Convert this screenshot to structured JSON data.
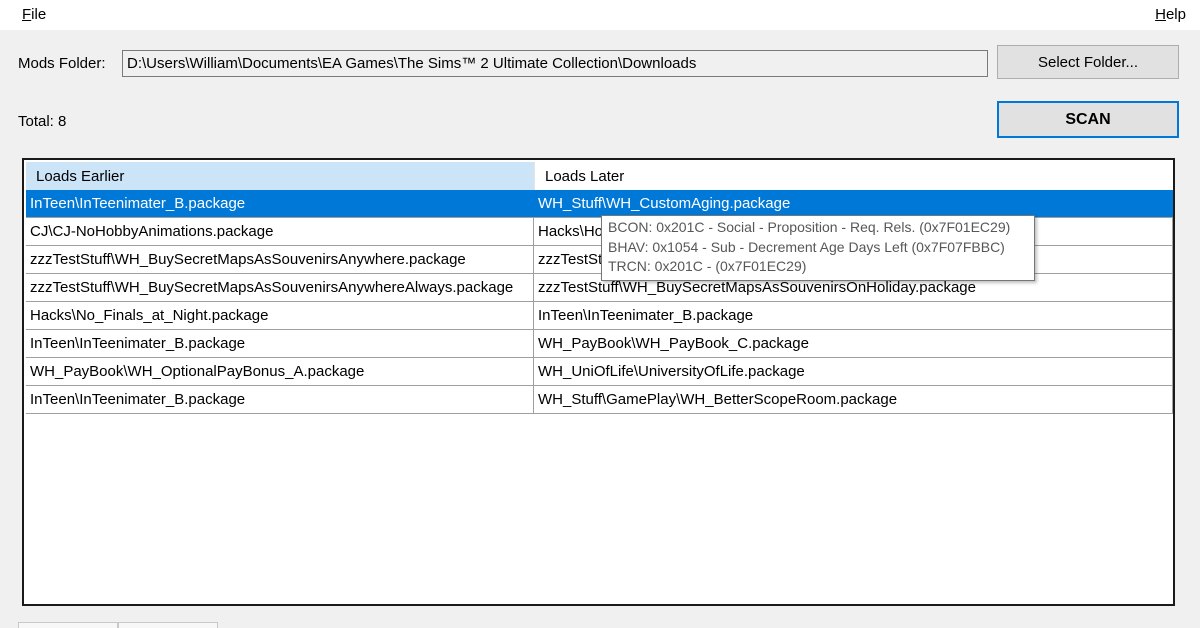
{
  "menu": {
    "file_label": "F",
    "file_rest": "ile",
    "help_label": "H",
    "help_rest": "elp"
  },
  "folder": {
    "label": "Mods Folder:",
    "value": "D:\\Users\\William\\Documents\\EA Games\\The Sims™ 2 Ultimate Collection\\Downloads",
    "select_button": "Select Folder..."
  },
  "scan_button": "SCAN",
  "total_label": "Total: 8",
  "table": {
    "headers": {
      "earlier": "Loads Earlier",
      "later": "Loads Later"
    },
    "rows": [
      {
        "earlier": "InTeen\\InTeenimater_B.package",
        "later": "WH_Stuff\\WH_CustomAging.package",
        "selected": true
      },
      {
        "earlier": "CJ\\CJ-NoHobbyAnimations.package",
        "later": "Hacks\\Ho"
      },
      {
        "earlier": "zzzTestStuff\\WH_BuySecretMapsAsSouvenirsAnywhere.package",
        "later": "zzzTestSt"
      },
      {
        "earlier": "zzzTestStuff\\WH_BuySecretMapsAsSouvenirsAnywhereAlways.package",
        "later": "zzzTestStuff\\WH_BuySecretMapsAsSouvenirsOnHoliday.package"
      },
      {
        "earlier": "Hacks\\No_Finals_at_Night.package",
        "later": "InTeen\\InTeenimater_B.package"
      },
      {
        "earlier": "InTeen\\InTeenimater_B.package",
        "later": "WH_PayBook\\WH_PayBook_C.package"
      },
      {
        "earlier": "WH_PayBook\\WH_OptionalPayBonus_A.package",
        "later": "WH_UniOfLife\\UniversityOfLife.package"
      },
      {
        "earlier": "InTeen\\InTeenimater_B.package",
        "later": "WH_Stuff\\GamePlay\\WH_BetterScopeRoom.package"
      }
    ]
  },
  "tooltip": {
    "lines": [
      "BCON: 0x201C - Social - Proposition - Req. Rels. (0x7F01EC29)",
      "BHAV: 0x1054 - Sub - Decrement Age Days Left (0x7F07FBBC)",
      "TRCN: 0x201C -  (0x7F01EC29)"
    ]
  },
  "colors": {
    "selection": "#0078d7",
    "header_highlight": "#cce4f7",
    "tooltip_text": "#575757"
  }
}
